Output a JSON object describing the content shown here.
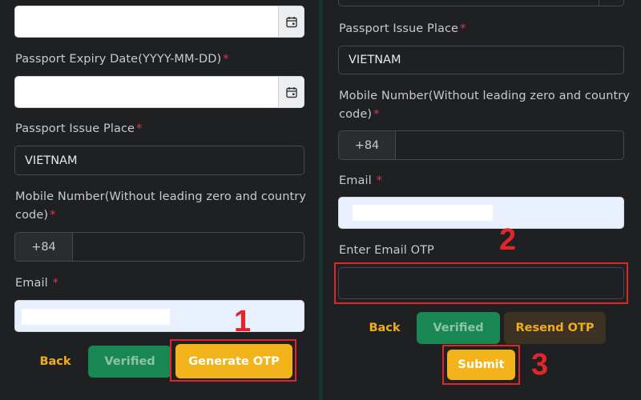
{
  "left": {
    "expiry_label": "Passport Expiry Date(YYYY-MM-DD)",
    "issue_label": "Passport Issue Place",
    "issue_value": "VIETNAM",
    "mobile_label_line1": "Mobile Number(Without leading zero and country",
    "mobile_label_line2": "code)",
    "country_code": "+84",
    "email_label": "Email",
    "required_mark": "*",
    "back_label": "Back",
    "verified_label": "Verified",
    "generate_otp_label": "Generate OTP",
    "step_number": "1"
  },
  "right": {
    "issue_label": "Passport Issue Place",
    "issue_value": "VIETNAM",
    "mobile_label_line1": "Mobile Number(Without leading zero and country",
    "mobile_label_line2": "code)",
    "country_code": "+84",
    "email_label": "Email",
    "otp_label": "Enter Email OTP",
    "required_mark": "*",
    "back_label": "Back",
    "verified_label": "Verified",
    "resend_otp_label": "Resend OTP",
    "submit_label": "Submit",
    "step_number_otp": "2",
    "step_number_submit": "3"
  },
  "colors": {
    "background": "#1f2022",
    "accent_yellow": "#f2b41a",
    "verified_green": "#198754",
    "highlight_red": "#e0262b",
    "required_red": "#e0364e"
  },
  "icons": [
    "calendar-icon"
  ]
}
